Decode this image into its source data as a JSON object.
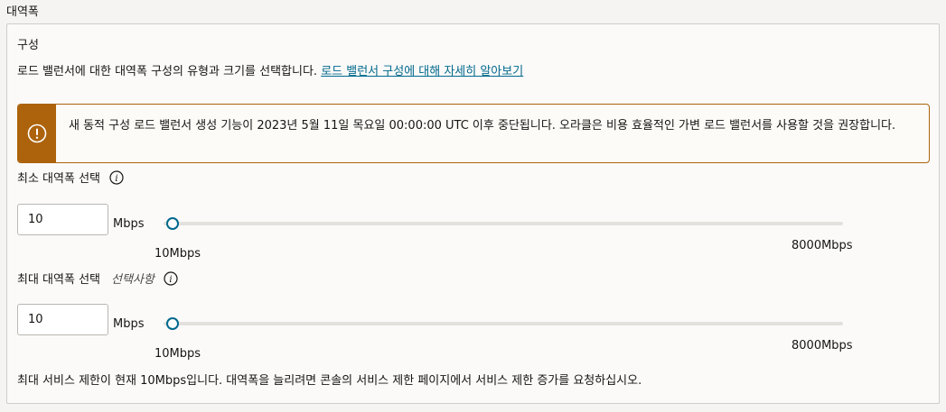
{
  "section": {
    "title": "대역폭"
  },
  "panel": {
    "heading": "구성",
    "description": "로드 밸런서에 대한 대역폭 구성의 유형과 크기를 선택합니다.",
    "link_text": "로드 밸런서 구성에 대해 자세히 알아보기"
  },
  "alert": {
    "icon": "warning-circle-icon",
    "message": "새 동적 구성 로드 밸런서 생성 기능이 2023년 5월 11일 목요일 00:00:00 UTC 이후 중단됩니다. 오라클은 비용 효율적인 가변 로드 밸런서를 사용할 것을 권장합니다."
  },
  "min_bandwidth": {
    "label": "최소 대역폭 선택",
    "value": "10",
    "unit": "Mbps",
    "slider_position": 0,
    "range_min_label": "10Mbps",
    "range_max_label": "8000Mbps"
  },
  "max_bandwidth": {
    "label": "최대 대역폭 선택",
    "optional_label": "선택사항",
    "value": "10",
    "unit": "Mbps",
    "slider_position": 0,
    "range_min_label": "10Mbps",
    "range_max_label": "8000Mbps"
  },
  "footnote": "최대 서비스 제한이 현재 10Mbps입니다. 대역폭을 늘리려면 콘솔의 서비스 제한 페이지에서 서비스 제한 증가를 요청하십시오.",
  "colors": {
    "accent": "#00688c",
    "warning": "#ac630c"
  }
}
